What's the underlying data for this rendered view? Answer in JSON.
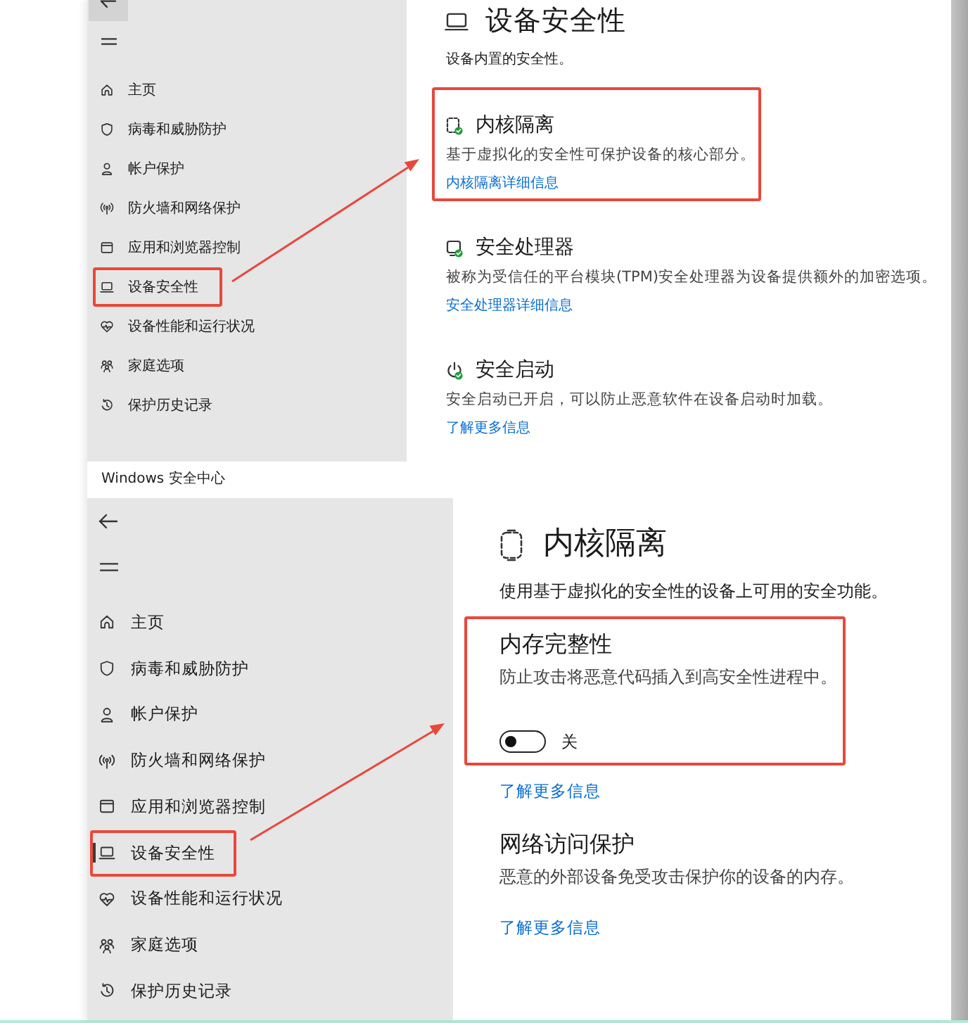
{
  "screens": [
    {
      "sidebar": {
        "items": [
          {
            "label": "主页",
            "highlighted": false
          },
          {
            "label": "病毒和威胁防护",
            "highlighted": false
          },
          {
            "label": "帐户保护",
            "highlighted": false
          },
          {
            "label": "防火墙和网络保护",
            "highlighted": false
          },
          {
            "label": "应用和浏览器控制",
            "highlighted": false
          },
          {
            "label": "设备安全性",
            "highlighted": true
          },
          {
            "label": "设备性能和运行状况",
            "highlighted": false
          },
          {
            "label": "家庭选项",
            "highlighted": false
          },
          {
            "label": "保护历史记录",
            "highlighted": false
          }
        ]
      },
      "page": {
        "title": "设备安全性",
        "description": "设备内置的安全性。",
        "blocks": [
          {
            "kind": "section",
            "title": "内核隔离",
            "description": "基于虚拟化的安全性可保护设备的核心部分。",
            "link": "内核隔离详细信息",
            "highlighted": true
          },
          {
            "kind": "section",
            "title": "安全处理器",
            "description": "被称为受信任的平台模块(TPM)安全处理器为设备提供额外的加密选项。",
            "link": "安全处理器详细信息",
            "highlighted": false
          },
          {
            "kind": "section",
            "title": "安全启动",
            "description": "安全启动已开启，可以防止恶意软件在设备启动时加载。",
            "link": "了解更多信息",
            "highlighted": false
          }
        ]
      }
    },
    {
      "window": {
        "title": "Windows 安全中心"
      },
      "sidebar": {
        "items": [
          {
            "label": "主页",
            "highlighted": false,
            "selected": false
          },
          {
            "label": "病毒和威胁防护",
            "highlighted": false,
            "selected": false
          },
          {
            "label": "帐户保护",
            "highlighted": false,
            "selected": false
          },
          {
            "label": "防火墙和网络保护",
            "highlighted": false,
            "selected": false
          },
          {
            "label": "应用和浏览器控制",
            "highlighted": false,
            "selected": false
          },
          {
            "label": "设备安全性",
            "highlighted": true,
            "selected": true
          },
          {
            "label": "设备性能和运行状况",
            "highlighted": false,
            "selected": false
          },
          {
            "label": "家庭选项",
            "highlighted": false,
            "selected": false
          },
          {
            "label": "保护历史记录",
            "highlighted": false,
            "selected": false
          }
        ]
      },
      "page": {
        "title": "内核隔离",
        "description": "使用基于虚拟化的安全性的设备上可用的安全功能。",
        "blocks": [
          {
            "kind": "section",
            "title": "内存完整性",
            "description": "防止攻击将恶意代码插入到高安全性进程中。",
            "toggle": {
              "on": false,
              "label": "关"
            },
            "highlighted": true
          },
          {
            "kind": "link",
            "label": "了解更多信息"
          },
          {
            "kind": "section",
            "title": "网络访问保护",
            "description": "恶意的外部设备免受攻击保护你的设备的内存。",
            "highlighted": false
          },
          {
            "kind": "link",
            "label": "了解更多信息"
          }
        ]
      }
    }
  ]
}
